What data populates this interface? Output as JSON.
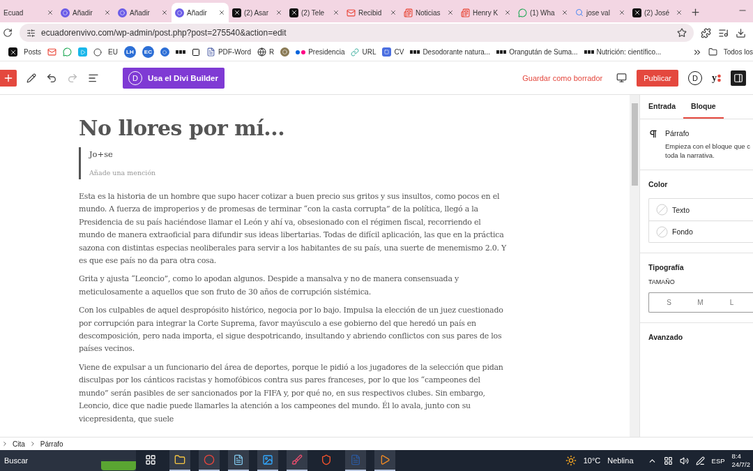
{
  "browser": {
    "tabs": [
      {
        "label": "Ecuad",
        "selected": false
      },
      {
        "label": "Añadir",
        "selected": false
      },
      {
        "label": "Añadir",
        "selected": false
      },
      {
        "label": "Añadir",
        "selected": true
      },
      {
        "label": "(2) Asar",
        "selected": false
      },
      {
        "label": "(2) Tele",
        "selected": false
      },
      {
        "label": "Recibid",
        "selected": false
      },
      {
        "label": "Noticias",
        "selected": false
      },
      {
        "label": "Henry K",
        "selected": false
      },
      {
        "label": "(1) Wha",
        "selected": false
      },
      {
        "label": "jose val",
        "selected": false
      },
      {
        "label": "(2) José",
        "selected": false
      }
    ],
    "url": "ecuadorenvivo.com/wp-admin/post.php?post=275540&action=edit",
    "bookmarks": [
      {
        "kind": "icon"
      },
      {
        "kind": "text",
        "label": "Posts"
      },
      {
        "kind": "icon"
      },
      {
        "kind": "icon"
      },
      {
        "kind": "icon"
      },
      {
        "kind": "icon"
      },
      {
        "kind": "text",
        "label": "EU"
      },
      {
        "kind": "badge",
        "label": "LH"
      },
      {
        "kind": "badge",
        "label": "EC"
      },
      {
        "kind": "icon"
      },
      {
        "kind": "icon"
      },
      {
        "kind": "icon"
      },
      {
        "kind": "icon-text",
        "label": "PDF-Word"
      },
      {
        "kind": "icon-text",
        "label": "R"
      },
      {
        "kind": "icon"
      },
      {
        "kind": "icon-text",
        "label": "Presidencia"
      },
      {
        "kind": "icon-text",
        "label": "URL"
      },
      {
        "kind": "icon-text",
        "label": "CV"
      },
      {
        "kind": "icon-text",
        "label": "Desodorante natura..."
      },
      {
        "kind": "icon-text",
        "label": "Orangután de Suma..."
      },
      {
        "kind": "icon-text",
        "label": "Nutrición: científico..."
      }
    ],
    "all_bookmarks": "Todos los"
  },
  "editor_toolbar": {
    "divi_button_mark": "D",
    "divi_button": "Usa el Divi Builder",
    "save_draft": "Guardar como borrador",
    "publish": "Publicar",
    "divi_logo": "D",
    "yoast_logo": "y"
  },
  "post": {
    "title": "No llores por mí...",
    "quote": {
      "text": "Jo+se",
      "citation_placeholder": "Añade una mención"
    },
    "paragraphs": [
      "Esta es la historia de un hombre que supo hacer cotizar a buen precio sus gritos y sus insultos, como pocos en el mundo. A fuerza de improperios y de promesas de terminar “con la casta corrupta” de la política, llegó a la Presidencia de su país haciéndose llamar el León y ahí va, obsesionado con el régimen fiscal, recorriendo el mundo de manera extraoficial para difundir sus ideas libertarias. Todas de difícil aplicación, las que en la práctica sazona con distintas especias neoliberales para servir a los habitantes de su país, una suerte de menemismo 2.0. Y es que ese país no da para otra cosa.",
      "Grita y ajusta “Leoncio”, como lo apodan algunos. Despide a mansalva y no de manera consensuada y meticulosamente a aquellos que son fruto de 30 años de corrupción sistémica.",
      "Con los culpables de aquel despropósito histórico, negocia por lo bajo. Impulsa la elección de un juez cuestionado por corrupción para integrar la Corte Suprema, favor mayúsculo a ese gobierno del que heredó un país en descomposición, pero nada importa, el sigue despotricando, insultando y abriendo conflictos con sus pares de los países vecinos.",
      "Viene de expulsar a un funcionario del área de deportes, porque le pidió a los jugadores de la selección que pidan disculpas por los cánticos racistas y homofóbicos contra sus pares franceses, por lo que los “campeones del mundo” serán pasibles de ser sancionados por la FIFA y, por qué no, en sus respectivos clubes. Sin embargo, Leoncio, dice que nadie puede llamarles la atención a los campeones del mundo. Él lo avala, junto con su vicepresidenta, que suele"
    ]
  },
  "sidebar": {
    "tabs": [
      {
        "label": "Entrada",
        "selected": false
      },
      {
        "label": "Bloque",
        "selected": true
      }
    ],
    "block": {
      "name": "Párrafo",
      "description": [
        "Empieza con el bloque que c",
        "toda la narrativa."
      ]
    },
    "color": {
      "title": "Color",
      "items": [
        "Texto",
        "Fondo"
      ]
    },
    "typography": {
      "title": "Tipografía",
      "size_label": "TAMAÑO",
      "sizes": [
        {
          "label": "S",
          "selected": false
        },
        {
          "label": "M",
          "selected": false
        },
        {
          "label": "L",
          "selected": false
        }
      ]
    },
    "advanced": "Avanzado"
  },
  "breadcrumb": [
    "Cita",
    "Párrafo"
  ],
  "taskbar": {
    "search": "Buscar",
    "apps": [
      {
        "active": false
      },
      {
        "active": true
      },
      {
        "active": true
      },
      {
        "active": true
      },
      {
        "active": true
      },
      {
        "active": true
      },
      {
        "active": false
      },
      {
        "active": true
      },
      {
        "active": true
      }
    ],
    "weather_temp": "10°C",
    "weather_text": "Neblina",
    "language": "ESP",
    "time": "8:4",
    "date": "24/7/2"
  }
}
